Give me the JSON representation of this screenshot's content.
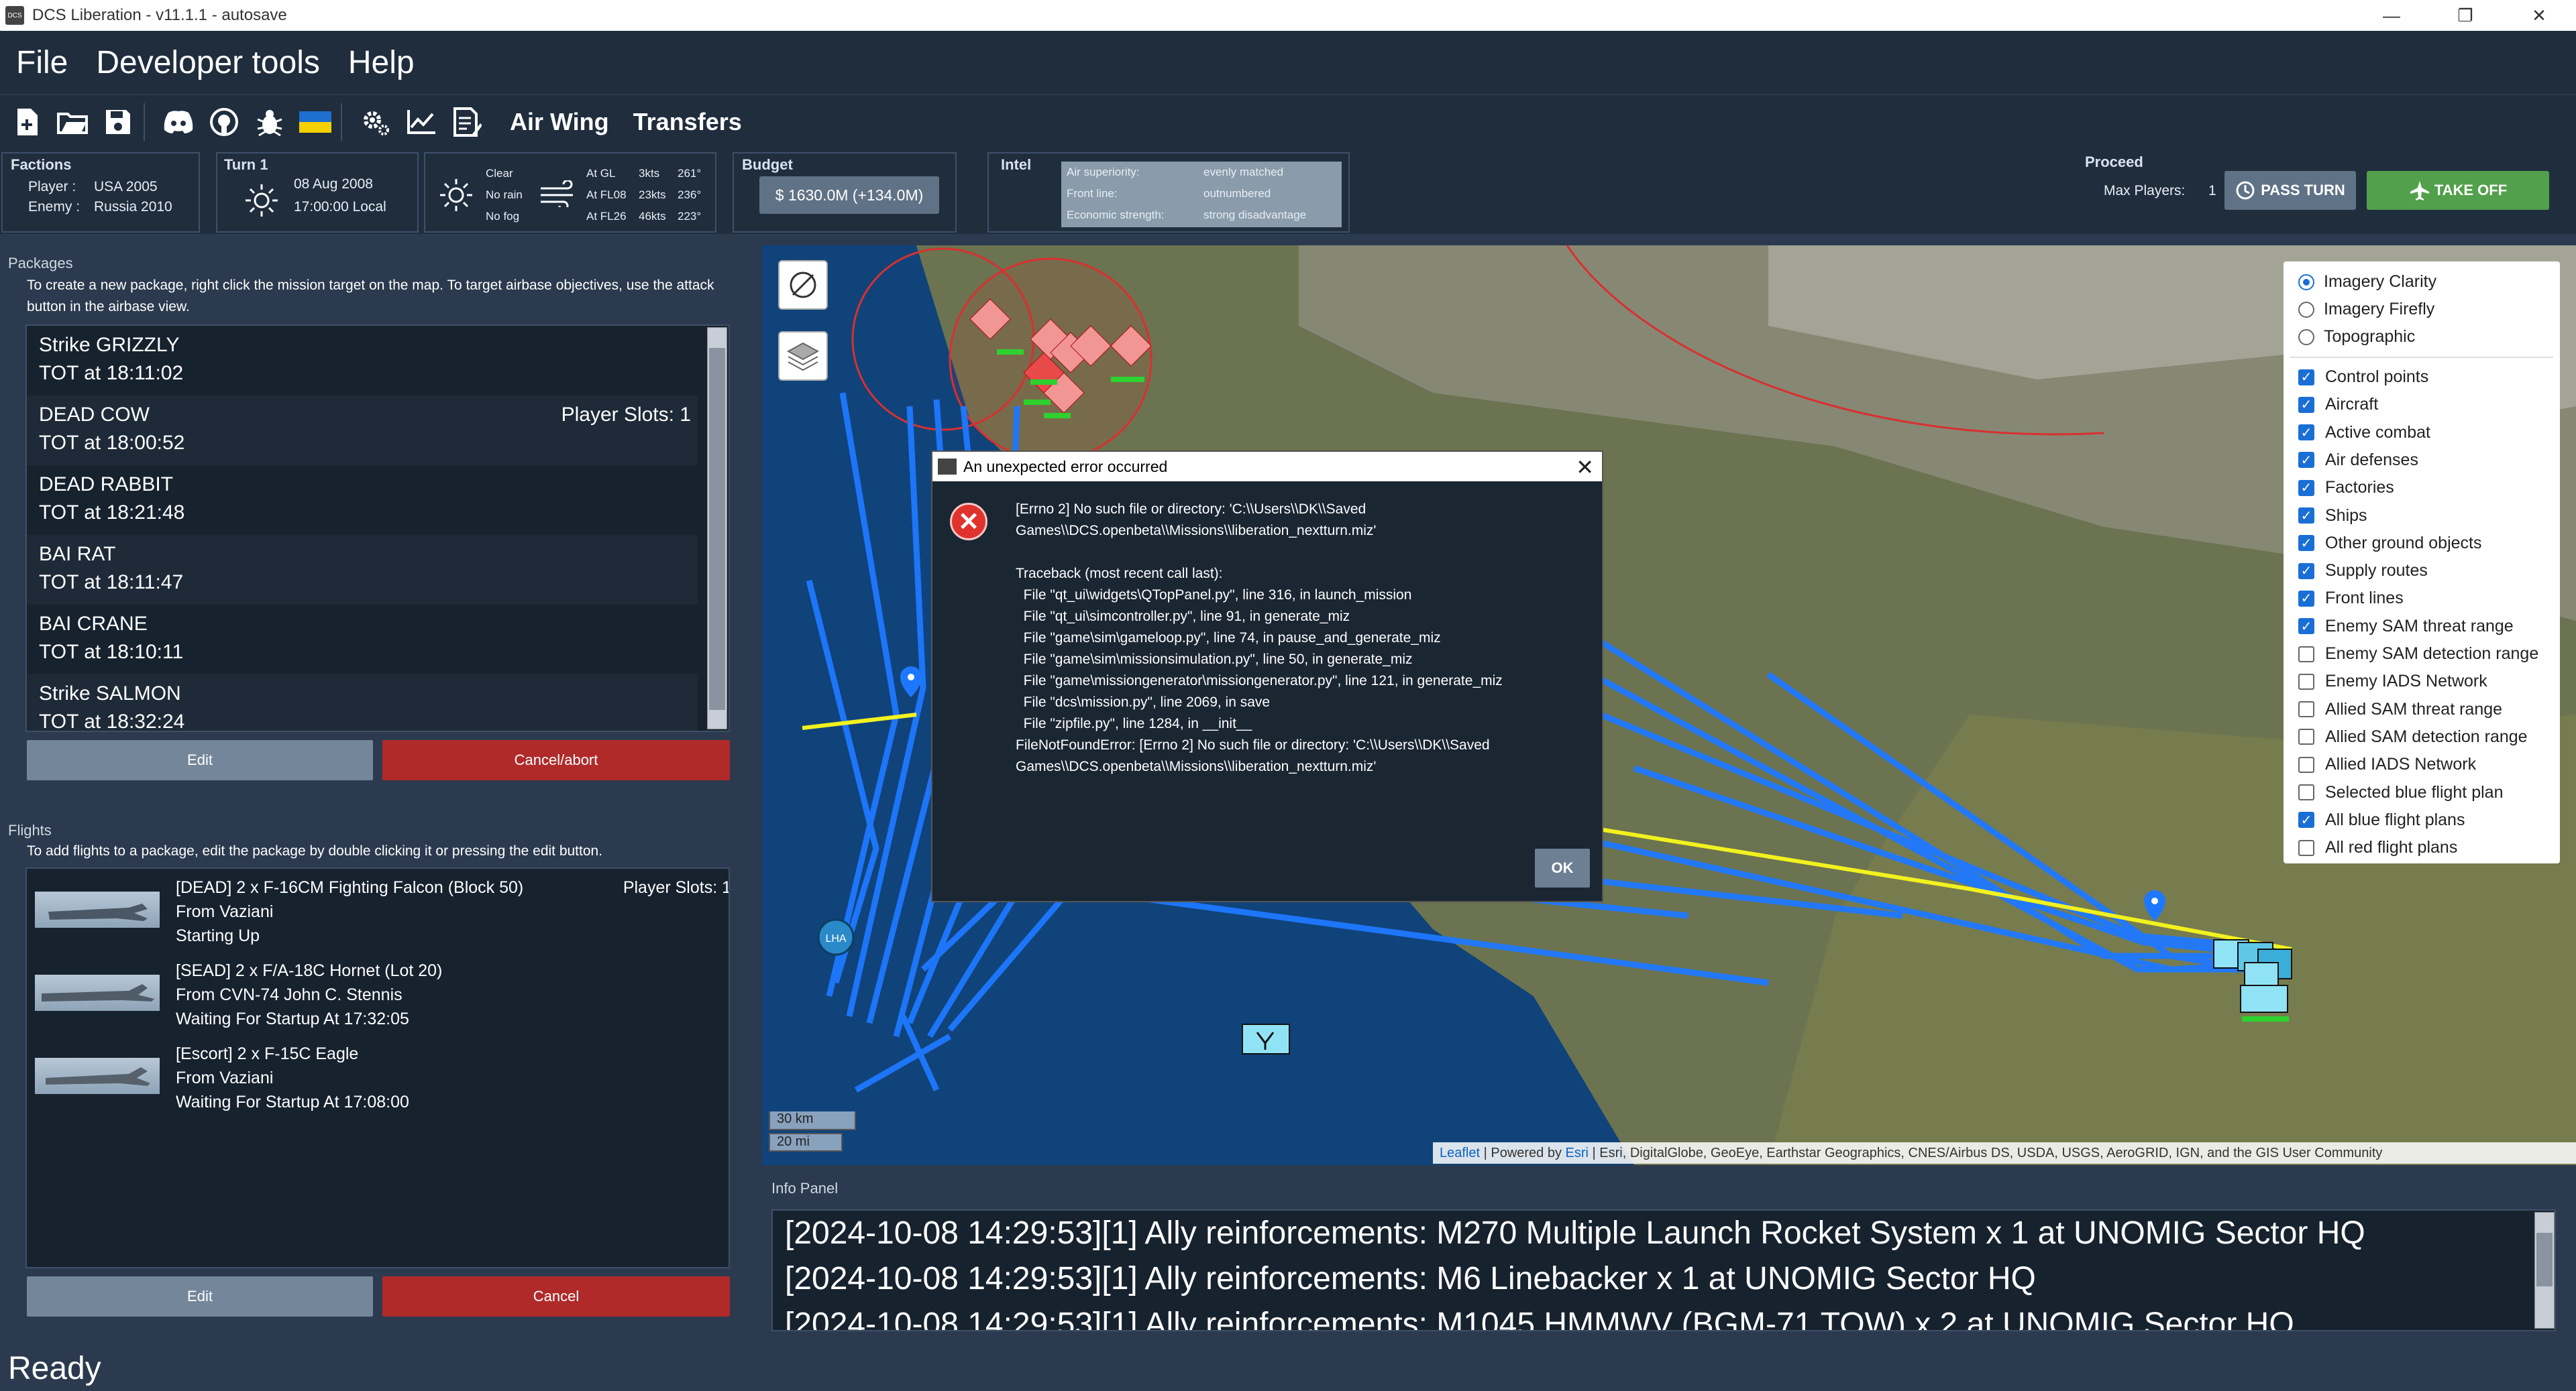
{
  "window": {
    "title": "DCS Liberation - v11.1.1 - autosave",
    "app_icon_text": "DCS",
    "min_glyph": "—",
    "max_glyph": "❐",
    "close_glyph": "✕"
  },
  "menu": [
    "File",
    "Developer tools",
    "Help"
  ],
  "toolbar": {
    "icons": [
      "new-file-icon",
      "open-folder-icon",
      "save-icon",
      "discord-icon",
      "github-icon",
      "bug-icon",
      "ukraine-flag-icon",
      "settings-icon",
      "stats-chart-icon",
      "notes-icon"
    ],
    "air_wing": "Air Wing",
    "transfers": "Transfers"
  },
  "factions": {
    "label": "Factions",
    "player_label": "Player :",
    "player": "USA 2005",
    "enemy_label": "Enemy :",
    "enemy": "Russia 2010"
  },
  "turn": {
    "label": "Turn 1",
    "date": "08 Aug 2008",
    "time": "17:00:00 Local"
  },
  "weather": {
    "lines": [
      "Clear",
      "No rain",
      "No fog"
    ],
    "wind": [
      {
        "alt": "At GL",
        "speed": "3kts",
        "dir": "261°"
      },
      {
        "alt": "At FL08",
        "speed": "23kts",
        "dir": "236°"
      },
      {
        "alt": "At FL26",
        "speed": "46kts",
        "dir": "223°"
      }
    ]
  },
  "budget": {
    "label": "Budget",
    "value": "$ 1630.0M (+134.0M)"
  },
  "intel": {
    "label": "Intel",
    "rows": [
      {
        "k": "Air superiority:",
        "v": "evenly matched"
      },
      {
        "k": "Front line:",
        "v": "outnumbered"
      },
      {
        "k": "Economic strength:",
        "v": "strong disadvantage"
      }
    ]
  },
  "proceed": {
    "label": "Proceed",
    "max_players": "Max Players:",
    "max_players_value": "1",
    "pass_turn": "PASS TURN",
    "take_off": "TAKE OFF"
  },
  "packages": {
    "title": "Packages",
    "hint": "To create a new package, right click the mission target on the map. To target airbase objectives, use the attack button in the airbase view.",
    "items": [
      {
        "name": "Strike GRIZZLY",
        "tot": "TOT at 18:11:02",
        "slots": ""
      },
      {
        "name": "DEAD COW",
        "tot": "TOT at 18:00:52",
        "slots": "Player Slots: 1"
      },
      {
        "name": "DEAD RABBIT",
        "tot": "TOT at 18:21:48",
        "slots": ""
      },
      {
        "name": "BAI RAT",
        "tot": "TOT at 18:11:47",
        "slots": ""
      },
      {
        "name": "BAI CRANE",
        "tot": "TOT at 18:10:11",
        "slots": ""
      },
      {
        "name": "Strike SALMON",
        "tot": "TOT at 18:32:24",
        "slots": ""
      }
    ],
    "edit": "Edit",
    "cancel": "Cancel/abort"
  },
  "flights": {
    "title": "Flights",
    "hint": "To add flights to a package, edit the package by double clicking it or pressing the edit button.",
    "items": [
      {
        "line1": "[DEAD] 2 x F-16CM Fighting Falcon (Block 50)",
        "line2": "From Vaziani",
        "line3": "Starting Up",
        "slots": "Player Slots: 1"
      },
      {
        "line1": "[SEAD] 2 x F/A-18C Hornet (Lot 20)",
        "line2": "From CVN-74 John C. Stennis",
        "line3": "Waiting For Startup At 17:32:05",
        "slots": ""
      },
      {
        "line1": "[Escort] 2 x F-15C Eagle",
        "line2": "From Vaziani",
        "line3": "Waiting For Startup At 17:08:00",
        "slots": ""
      }
    ],
    "edit": "Edit",
    "cancel": "Cancel"
  },
  "map": {
    "base_layers": [
      {
        "label": "Imagery Clarity",
        "checked": true
      },
      {
        "label": "Imagery Firefly",
        "checked": false
      },
      {
        "label": "Topographic",
        "checked": false
      }
    ],
    "overlays": [
      {
        "label": "Control points",
        "checked": true
      },
      {
        "label": "Aircraft",
        "checked": true
      },
      {
        "label": "Active combat",
        "checked": true
      },
      {
        "label": "Air defenses",
        "checked": true
      },
      {
        "label": "Factories",
        "checked": true
      },
      {
        "label": "Ships",
        "checked": true
      },
      {
        "label": "Other ground objects",
        "checked": true
      },
      {
        "label": "Supply routes",
        "checked": true
      },
      {
        "label": "Front lines",
        "checked": true
      },
      {
        "label": "Enemy SAM threat range",
        "checked": true
      },
      {
        "label": "Enemy SAM detection range",
        "checked": false
      },
      {
        "label": "Enemy IADS Network",
        "checked": false
      },
      {
        "label": "Allied SAM threat range",
        "checked": false
      },
      {
        "label": "Allied SAM detection range",
        "checked": false
      },
      {
        "label": "Allied IADS Network",
        "checked": false
      },
      {
        "label": "Selected blue flight plan",
        "checked": false
      },
      {
        "label": "All blue flight plans",
        "checked": true
      },
      {
        "label": "All red flight plans",
        "checked": false
      }
    ],
    "scale_km": "30 km",
    "scale_mi": "20 mi",
    "lha_label": "LHA",
    "attribution_leaflet": "Leaflet",
    "attribution_powered": " | Powered by ",
    "attribution_esri": "Esri",
    "attribution_rest": " | Esri, DigitalGlobe, GeoEye, Earthstar Geographics, CNES/Airbus DS, USDA, USGS, AeroGRID, IGN, and the GIS User Community",
    "colors": {
      "blue_route": "#1e78ff",
      "yellow_line": "#f2f21e",
      "red_zone": "#d93030"
    }
  },
  "dialog": {
    "title": "An unexpected error occurred",
    "close": "✕",
    "message": "[Errno 2] No such file or directory: 'C:\\\\Users\\\\DK\\\\Saved Games\\\\DCS.openbeta\\\\Missions\\\\liberation_nextturn.miz'\n\nTraceback (most recent call last):\n  File \"qt_ui\\widgets\\QTopPanel.py\", line 316, in launch_mission\n  File \"qt_ui\\simcontroller.py\", line 91, in generate_miz\n  File \"game\\sim\\gameloop.py\", line 74, in pause_and_generate_miz\n  File \"game\\sim\\missionsimulation.py\", line 50, in generate_miz\n  File \"game\\missiongenerator\\missiongenerator.py\", line 121, in generate_miz\n  File \"dcs\\mission.py\", line 2069, in save\n  File \"zipfile.py\", line 1284, in __init__\nFileNotFoundError: [Errno 2] No such file or directory: 'C:\\\\Users\\\\DK\\\\Saved Games\\\\DCS.openbeta\\\\Missions\\\\liberation_nextturn.miz'",
    "ok": "OK"
  },
  "info_panel": {
    "title": "Info Panel",
    "lines": [
      "[2024-10-08 14:29:53][1] Ally reinforcements: M270 Multiple Launch Rocket System x 1 at UNOMIG Sector HQ",
      "[2024-10-08 14:29:53][1] Ally reinforcements: M6 Linebacker x 1 at UNOMIG Sector HQ",
      "[2024-10-08 14:29:53][1] Ally reinforcements: M1045 HMMWV (BGM-71 TOW) x 2 at UNOMIG Sector HQ"
    ]
  },
  "status": "Ready"
}
